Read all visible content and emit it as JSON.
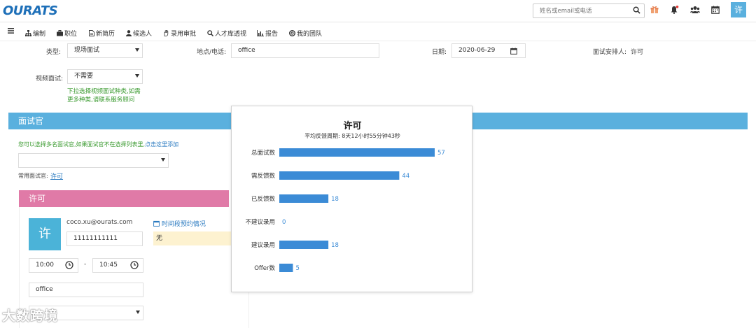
{
  "header": {
    "logo": "OURATS",
    "search_placeholder": "姓名或email或电话",
    "user_initial": "许"
  },
  "nav": {
    "items": [
      {
        "label": "编制",
        "icon": "org-chart-icon"
      },
      {
        "label": "职位",
        "icon": "briefcase-icon"
      },
      {
        "label": "新简历",
        "icon": "document-icon"
      },
      {
        "label": "候选人",
        "icon": "person-icon"
      },
      {
        "label": "录用审批",
        "icon": "hand-icon"
      },
      {
        "label": "人才库透视",
        "icon": "search-icon"
      },
      {
        "label": "报告",
        "icon": "bar-chart-icon"
      },
      {
        "label": "我的团队",
        "icon": "life-ring-icon"
      }
    ]
  },
  "form": {
    "type_label": "类型:",
    "type_value": "现场面试",
    "location_label": "地点/电话:",
    "location_value": "office",
    "date_label": "日期:",
    "date_value": "2020-06-29",
    "arranger_label": "面试安排人:",
    "arranger_value": "许可",
    "video_label": "视频面试:",
    "video_value": "不需要",
    "video_hint_line1": "下拉选择视频面试种类,如需",
    "video_hint_line2": "更多种类,请联系服务顾问"
  },
  "interviewer_section": {
    "title": "面试官",
    "hint": "您可以选择多名面试官,如果面试官不在选择列表里,",
    "hint_link": "点击这里添加",
    "common_label": "常用面试官:",
    "common_value": "许可"
  },
  "interviewer_card": {
    "name": "许可",
    "avatar_initial": "许",
    "email": "coco.xu@ourats.com",
    "phone": "11111111111",
    "schedule_link": "时间段预约情况",
    "schedule_value": "无",
    "start_time": "10:00",
    "separator": "-",
    "end_time": "10:45",
    "location": "office"
  },
  "popover": {
    "title": "许可",
    "subtitle": "平均反馈周期: 8天12小时55分钟43秒"
  },
  "chart_data": {
    "type": "bar",
    "orientation": "horizontal",
    "categories": [
      "总面试数",
      "需反馈数",
      "已反馈数",
      "不建议录用",
      "建议录用",
      "Offer数"
    ],
    "values": [
      57,
      44,
      18,
      0,
      18,
      5
    ],
    "xlim": [
      0,
      64
    ],
    "color": "#3b8bd6"
  },
  "watermark": "大数跨境",
  "colors": {
    "accent_blue": "#5ab0de",
    "pink": "#e07aa7",
    "green_hint": "#3a9a2f",
    "bar_blue": "#3b8bd6"
  }
}
